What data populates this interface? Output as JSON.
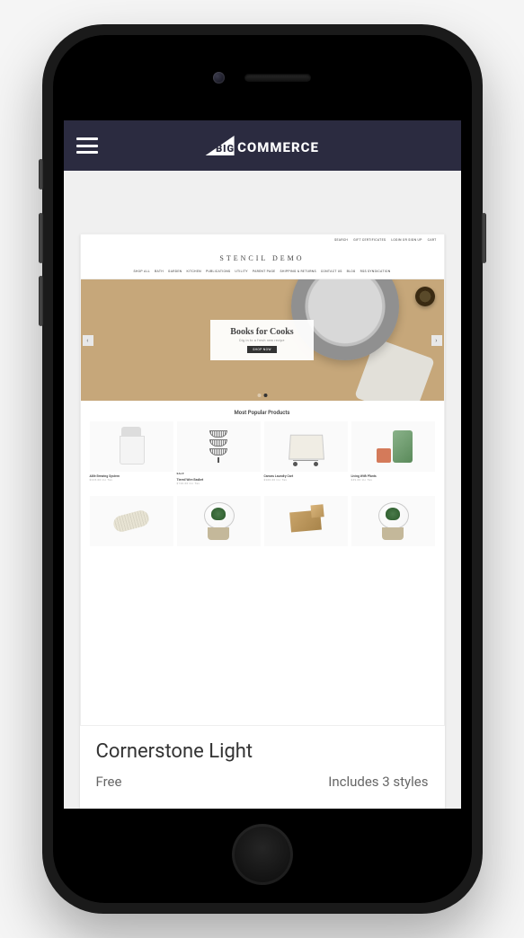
{
  "brand": {
    "big": "BIG",
    "commerce": "COMMERCE"
  },
  "theme": {
    "title": "Cornerstone Light",
    "price": "Free",
    "styles_text": "Includes 3 styles"
  },
  "preview": {
    "util": [
      "SEARCH",
      "GIFT CERTIFICATES",
      "LOGIN or SIGN UP",
      "CART"
    ],
    "site_title": "STENCIL DEMO",
    "nav": [
      "SHOP ALL",
      "BATH",
      "GARDEN",
      "KITCHEN",
      "PUBLICATIONS",
      "UTILITY",
      "PARENT PAGE",
      "SHIPPING & RETURNS",
      "CONTACT US",
      "BLOG",
      "RSS SYNDICATION"
    ],
    "hero": {
      "headline": "Books for Cooks",
      "sub": "Dig in to a fresh new recipe",
      "cta": "Shop Now"
    },
    "popular_title": "Most Popular Products",
    "products": [
      {
        "name": "Able Brewing System",
        "price": "$225.00 Inc Tax"
      },
      {
        "name": "Tiered Wire Basket",
        "price": "$120.00 Inc Tax",
        "badge": "SALE"
      },
      {
        "name": "Canvas Laundry Cart",
        "price": "$200.00 Inc Tax"
      },
      {
        "name": "Living With Plants",
        "price": "$49.00 Inc Tax"
      }
    ]
  }
}
